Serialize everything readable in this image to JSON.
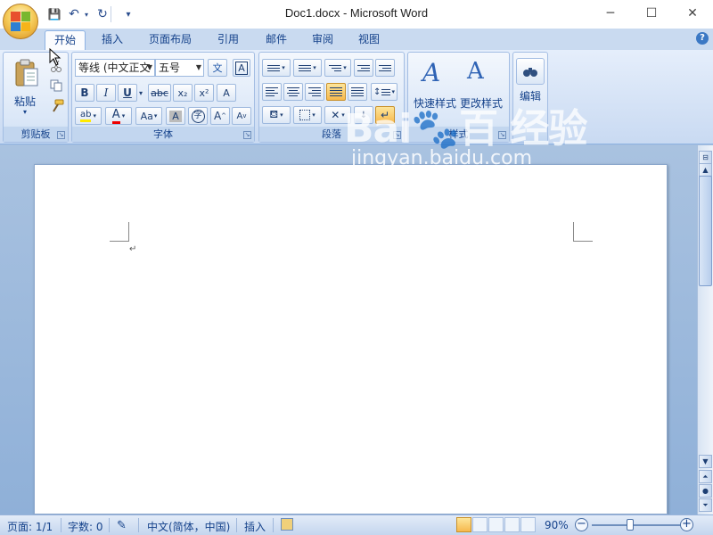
{
  "titlebar": {
    "title": "Doc1.docx - Microsoft Word",
    "qat": {
      "save": "💾",
      "undo": "↶",
      "redo": "↻",
      "customize": "▾"
    },
    "controls": {
      "minimize": "─",
      "maximize": "☐",
      "close": "✕"
    }
  },
  "tabs": [
    "开始",
    "插入",
    "页面布局",
    "引用",
    "邮件",
    "审阅",
    "视图"
  ],
  "help": "?",
  "ribbon": {
    "clipboard": {
      "label": "剪贴板",
      "paste": "粘贴"
    },
    "font": {
      "label": "字体",
      "font_name": "等线 (中文正文",
      "font_size": "五号",
      "bold": "B",
      "italic": "I",
      "underline": "U",
      "strike": "abc",
      "subscript": "x₂",
      "superscript": "x²",
      "highlight": "ab",
      "color": "A",
      "case": "Aa",
      "char_shade": "A",
      "enclose": "字",
      "grow": "A",
      "shrink": "A",
      "phonetic": "文",
      "border": "A",
      "clear": "A"
    },
    "paragraph": {
      "label": "段落"
    },
    "styles": {
      "label": "样式",
      "quick": "快速样式",
      "change": "更改样式"
    },
    "editing": {
      "label": "编辑"
    }
  },
  "document": {
    "paragraph_mark": "↵"
  },
  "statusbar": {
    "page": "页面: 1/1",
    "words": "字数: 0",
    "language": "中文(简体，中国)",
    "mode": "插入",
    "zoom": "90%",
    "zoom_minus": "−",
    "zoom_plus": "+"
  },
  "watermark": {
    "logo": "Bai🐾百 经验",
    "url": "jingyan.baidu.com"
  },
  "colors": {
    "accent": "#15428b",
    "ribbon": "#dbe7f7",
    "highlight": "#f8c860"
  }
}
